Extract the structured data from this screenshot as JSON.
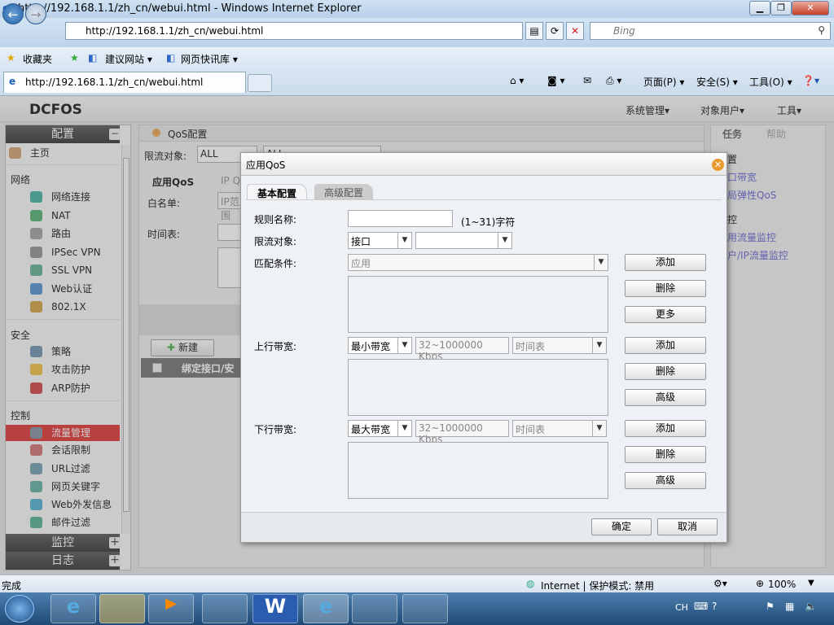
{
  "browser": {
    "title": "http://192.168.1.1/zh_cn/webui.html - Windows Internet Explorer",
    "address": "http://192.168.1.1/zh_cn/webui.html",
    "search_placeholder": "Bing",
    "favorites": "收藏夹",
    "suggested_sites": "建议网站 ▾",
    "web_slice": "网页快讯库 ▾",
    "tab_title": "http://192.168.1.1/zh_cn/webui.html",
    "cmd": {
      "page": "页面(P) ▾",
      "safety": "安全(S) ▾",
      "tools": "工具(O) ▾"
    }
  },
  "app": {
    "logo": "DCFOS",
    "menu": [
      "系统管理▾",
      "对象用户▾",
      "工具▾"
    ]
  },
  "sidebar": {
    "config_header": "配置",
    "home": "主页",
    "sections": [
      {
        "title": "网络",
        "items": [
          "网络连接",
          "NAT",
          "路由",
          "IPSec VPN",
          "SSL VPN",
          "Web认证",
          "802.1X"
        ]
      },
      {
        "title": "安全",
        "items": [
          "策略",
          "攻击防护",
          "ARP防护"
        ]
      },
      {
        "title": "控制",
        "items": [
          "流量管理",
          "会话限制",
          "URL过滤",
          "网页关键字",
          "Web外发信息",
          "邮件过滤"
        ]
      }
    ],
    "active": "流量管理",
    "monitor_header": "监控",
    "log_header": "日志"
  },
  "main": {
    "title": "QoS配置",
    "filter_label": "限流对象:",
    "filter_value": "ALL",
    "filter_value2": "ALL",
    "tabs": [
      "应用QoS",
      "IP QoS"
    ],
    "whitelist_label": "白名单:",
    "whitelist_placeholder": "IP范围",
    "schedule_label": "时间表:",
    "new_button": "新建",
    "col_header": "绑定接口/安"
  },
  "right_panel": {
    "tabs": [
      "任务",
      "帮助"
    ],
    "items": [
      "置",
      "口带宽",
      "局弹性QoS",
      "控",
      "用流量监控",
      "户/IP流量监控"
    ]
  },
  "dialog": {
    "title": "应用QoS",
    "tabs": [
      "基本配置",
      "高级配置"
    ],
    "rule_name_label": "规则名称:",
    "rule_name_value": "",
    "rule_name_hint": "(1~31)字符",
    "target_label": "限流对象:",
    "target_value": "接口",
    "target_value2": "",
    "match_label": "匹配条件:",
    "match_value": "应用",
    "up_label": "上行带宽:",
    "up_type": "最小带宽",
    "up_placeholder": "32~1000000 Kbps",
    "up_schedule": "时间表",
    "down_label": "下行带宽:",
    "down_type": "最大带宽",
    "down_placeholder": "32~1000000 Kbps",
    "down_schedule": "时间表",
    "add": "添加",
    "delete": "删除",
    "more": "更多",
    "advanced": "高级",
    "ok": "确定",
    "cancel": "取消"
  },
  "status": {
    "text": "完成",
    "zone": "Internet | 保护模式: 禁用",
    "zoom": "100%"
  },
  "taskbar": {
    "lang": "CH"
  }
}
